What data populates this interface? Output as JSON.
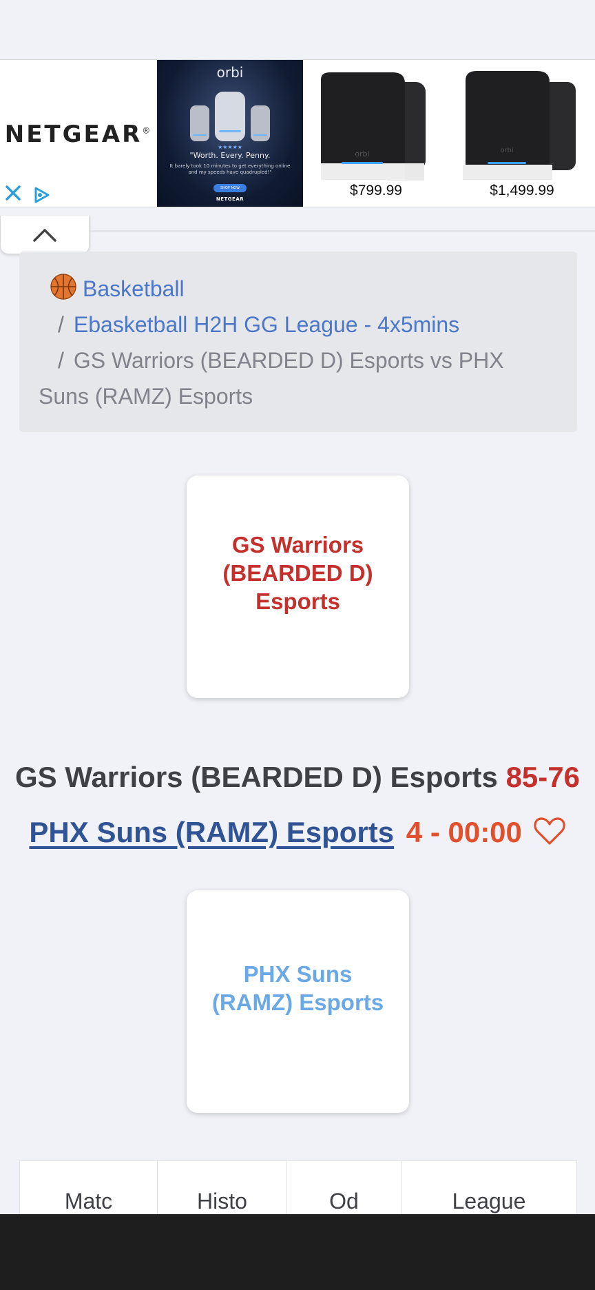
{
  "ad": {
    "brand": "NETGEAR",
    "brand_mark": "®",
    "tile": {
      "product": "orbi",
      "stars": "★★★★★",
      "quote": "\"Worth. Every. Penny.",
      "fine_print": "It barely took 10 minutes to get everything online and my speeds have quadrupled!\"",
      "shop_button": "SHOP NOW",
      "brand": "NETGEAR"
    },
    "products": [
      {
        "price": "$799.99",
        "label": "orbi"
      },
      {
        "price": "$1,499.99",
        "label": "orbi"
      }
    ],
    "accent_color": "#2b9fd8"
  },
  "breadcrumb": {
    "sport": "Basketball",
    "league": "Ebasketball H2H GG League - 4x5mins",
    "match": "GS Warriors (BEARDED D) Esports vs PHX Suns (RAMZ) Esports",
    "separator": "/"
  },
  "match": {
    "home_team": "GS Warriors (BEARDED D) Esports",
    "away_team": "PHX Suns (RAMZ) Esports",
    "score": "85-76",
    "status": "4 - 00:00",
    "home_color": "#c4302b",
    "away_color": "#6aa8e6"
  },
  "tabs": [
    "Matc",
    "Histo",
    "Od",
    "League"
  ]
}
